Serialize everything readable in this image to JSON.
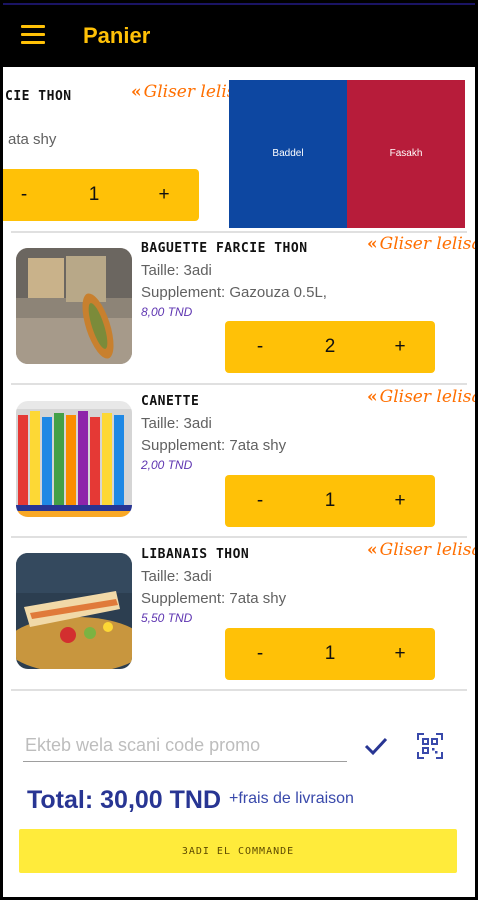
{
  "appbar": {
    "title": "Panier"
  },
  "swipe_hint": "Gliser lelisar",
  "revealed_item": {
    "name_partial": "CIE THON",
    "supplement_partial": "ata shy",
    "quantity": "1",
    "actions": [
      {
        "label": "Baddel",
        "color": "#0d47a1"
      },
      {
        "label": "Fasakh",
        "color": "#b71c3a"
      }
    ]
  },
  "stepper": {
    "minus": "-",
    "plus": "+"
  },
  "items": [
    {
      "name": "BAGUETTE FARCIE THON",
      "taille": "Taille: 3adi",
      "supplement": "Supplement: Gazouza 0.5L,",
      "price": "8,00 TND",
      "quantity": "2"
    },
    {
      "name": "CANETTE",
      "taille": "Taille: 3adi",
      "supplement": "Supplement: 7ata shy",
      "price": "2,00 TND",
      "quantity": "1"
    },
    {
      "name": "LIBANAIS THON",
      "taille": "Taille: 3adi",
      "supplement": "Supplement: 7ata shy",
      "price": "5,50 TND",
      "quantity": "1"
    }
  ],
  "promo": {
    "placeholder": "Ekteb wela scani code promo"
  },
  "total": {
    "label": "Total: 30,00 TND",
    "fees": "+frais de livraison"
  },
  "order_button": "3ADI EL COMMANDE",
  "colors": {
    "accent": "#ffc107",
    "total": "#283593",
    "price": "#5e35b1"
  }
}
